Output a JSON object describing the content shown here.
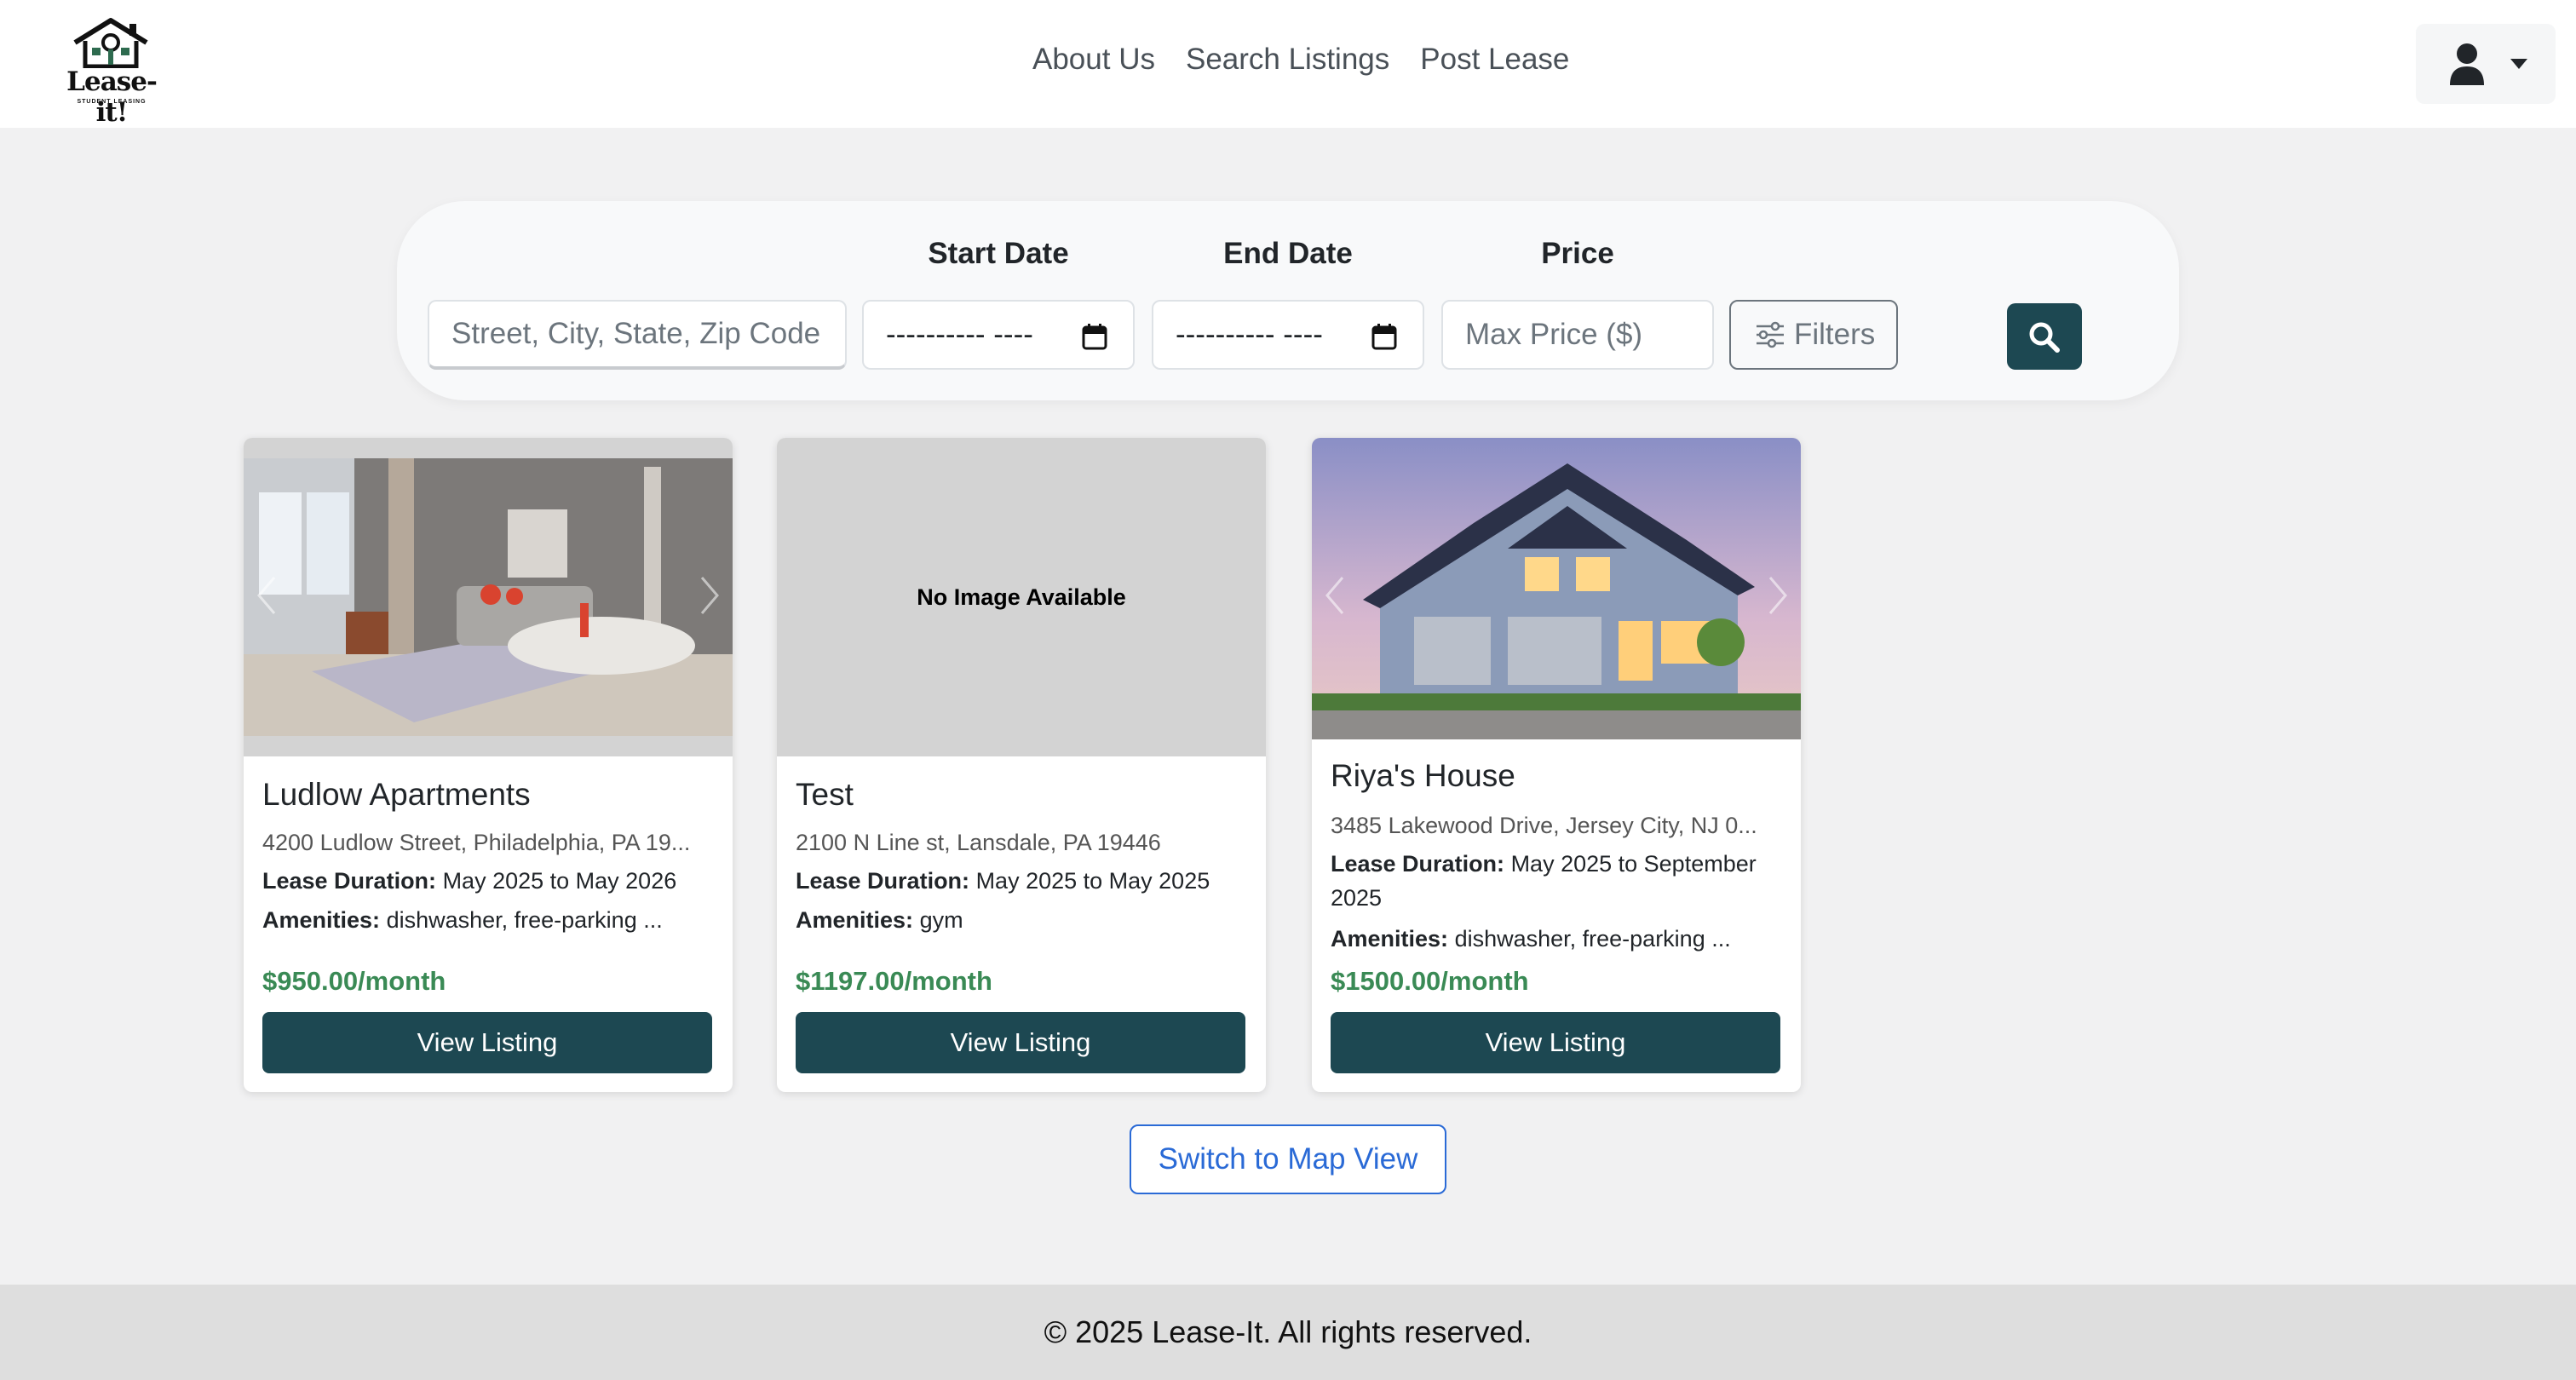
{
  "brand": {
    "name": "Lease-it!",
    "tagline": "STUDENT LEASING"
  },
  "nav": [
    {
      "label": "About Us"
    },
    {
      "label": "Search Listings"
    },
    {
      "label": "Post Lease"
    }
  ],
  "search": {
    "location_placeholder": "Street, City, State, Zip Code",
    "start_date_label": "Start Date",
    "start_date_value": "---------- ----",
    "end_date_label": "End Date",
    "end_date_value": "---------- ----",
    "price_label": "Price",
    "price_placeholder": "Max Price ($)",
    "filters_label": "Filters"
  },
  "listings": [
    {
      "title": "Ludlow Apartments",
      "address": "4200 Ludlow Street, Philadelphia, PA 19...",
      "lease_label": "Lease Duration:",
      "lease_value": "May 2025 to May 2026",
      "amenities_label": "Amenities:",
      "amenities_value": "dishwasher, free-parking ...",
      "price": "$950.00/month",
      "button": "View Listing"
    },
    {
      "title": "Test",
      "no_image": "No Image Available",
      "address": "2100 N Line st, Lansdale, PA 19446",
      "lease_label": "Lease Duration:",
      "lease_value": "May 2025 to May 2025",
      "amenities_label": "Amenities:",
      "amenities_value": "gym",
      "price": "$1197.00/month",
      "button": "View Listing"
    },
    {
      "title": "Riya's House",
      "address": "3485 Lakewood Drive, Jersey City, NJ 0...",
      "lease_label": "Lease Duration:",
      "lease_value": "May 2025 to September 2025",
      "amenities_label": "Amenities:",
      "amenities_value": "dishwasher, free-parking ...",
      "price": "$1500.00/month",
      "button": "View Listing"
    }
  ],
  "map_toggle": "Switch to Map View",
  "footer": "© 2025 Lease-It. All rights reserved.",
  "colors": {
    "primary": "#1d4852",
    "price": "#3a8a55",
    "link": "#2a6ad6",
    "page_bg": "#f1f1f2"
  }
}
